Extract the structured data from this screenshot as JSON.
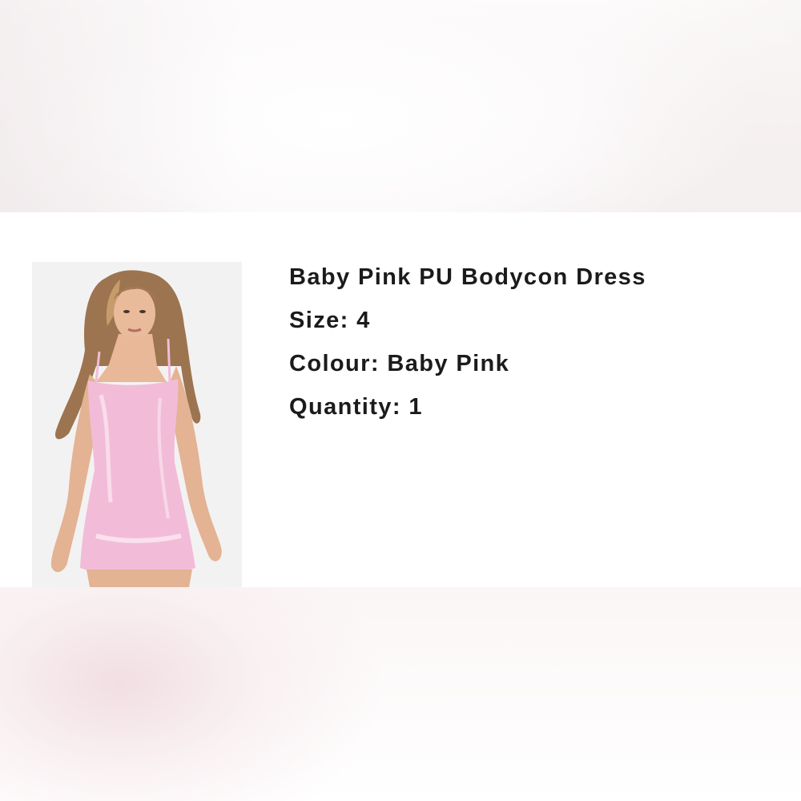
{
  "product": {
    "title": "Baby Pink PU Bodycon Dress",
    "size_label": "Size:",
    "size_value": "4",
    "colour_label": "Colour:",
    "colour_value": "Baby Pink",
    "quantity_label": "Quantity:",
    "quantity_value": "1",
    "dress_color": "#f2bcd8",
    "image": "product-photo-model-in-pink-dress"
  },
  "colors": {
    "text": "#1b1b1b",
    "card_background": "#ffffff",
    "photo_background": "#f3f2f2",
    "blur_pink": "#f1dde1"
  }
}
